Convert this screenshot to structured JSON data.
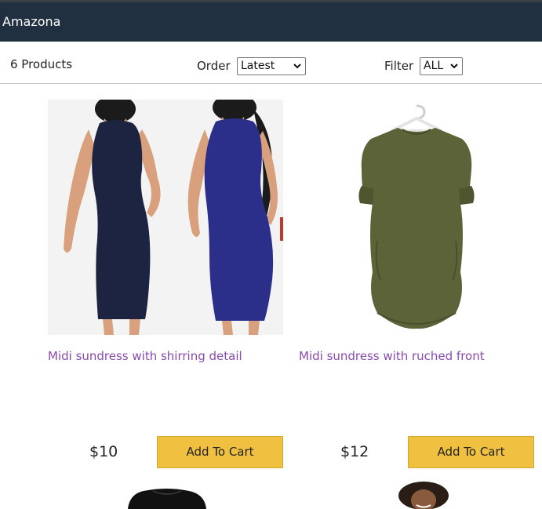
{
  "header": {
    "brand": "Amazona",
    "bg_color": "#203040"
  },
  "filter_bar": {
    "count_text": "6 Products",
    "order_label": "Order",
    "order_value": "Latest",
    "filter_label": "Filter",
    "filter_value": "ALL"
  },
  "products": [
    {
      "title": "Midi sundress with shirring detail",
      "price": "$10",
      "button": "Add To Cart",
      "image": "two-navy-bodycon-dresses-photo"
    },
    {
      "title": "Midi sundress with ruched front",
      "price": "$12",
      "button": "Add To Cart",
      "image": "olive-oversized-dress-on-hanger-photo"
    }
  ],
  "colors": {
    "link": "#8a4baf",
    "button": "#f0c040",
    "header": "#203040"
  }
}
